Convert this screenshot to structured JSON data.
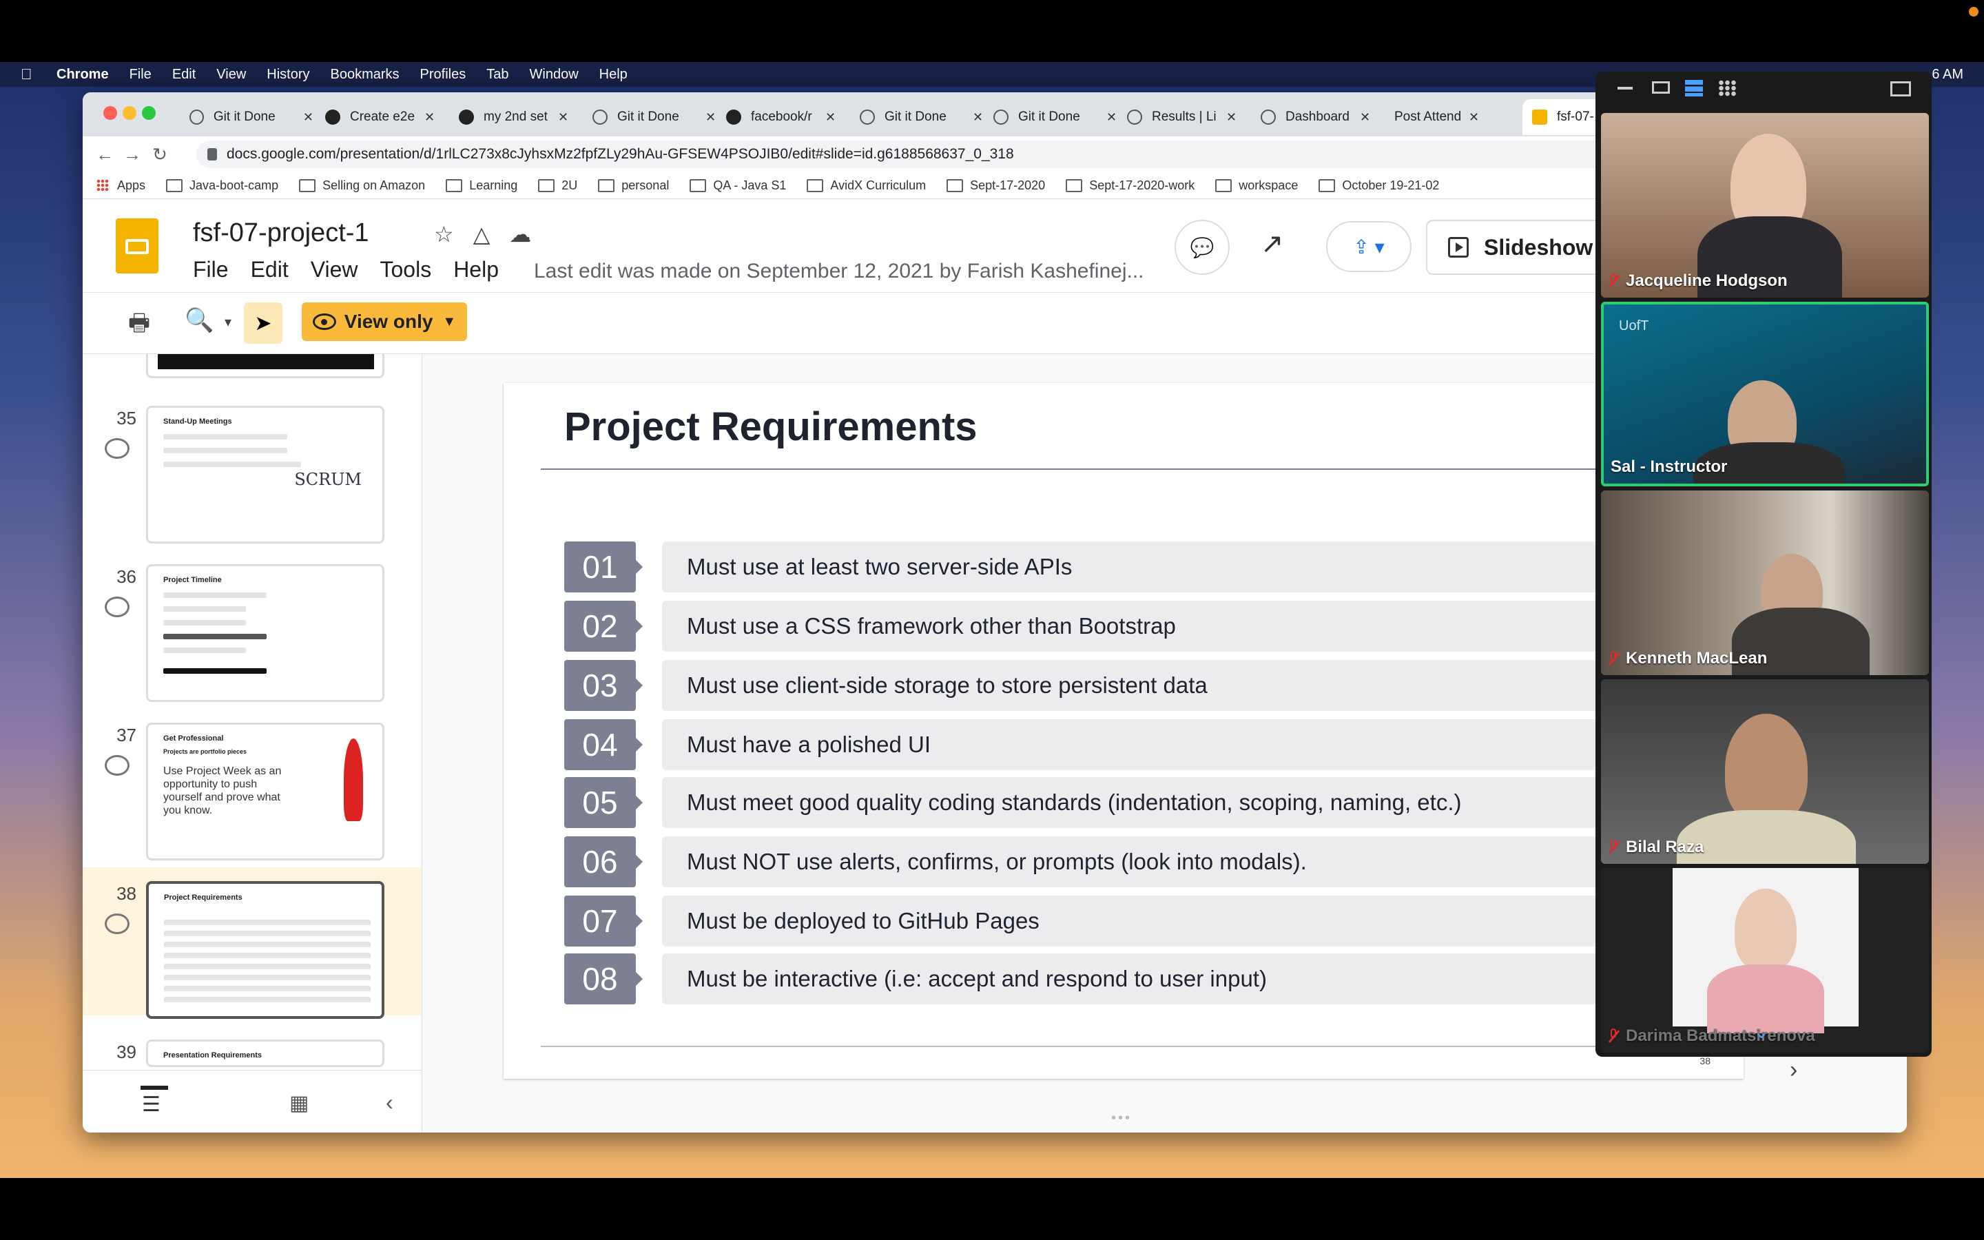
{
  "menubar": {
    "app": "Chrome",
    "items": [
      "File",
      "Edit",
      "View",
      "History",
      "Bookmarks",
      "Profiles",
      "Tab",
      "Window",
      "Help"
    ],
    "clock": "6 AM"
  },
  "browser": {
    "tabs": [
      {
        "label": "Git it Done",
        "icon": "globe-icon"
      },
      {
        "label": "Create e2e",
        "icon": "github-icon"
      },
      {
        "label": "my 2nd set",
        "icon": "github-icon"
      },
      {
        "label": "Git it Done",
        "icon": "globe-icon"
      },
      {
        "label": "facebook/r",
        "icon": "github-icon"
      },
      {
        "label": "Git it Done",
        "icon": "globe-icon"
      },
      {
        "label": "Git it Done",
        "icon": "globe-icon"
      },
      {
        "label": "Results | Li",
        "icon": "globe-icon"
      },
      {
        "label": "Dashboard",
        "icon": "globe-icon"
      },
      {
        "label": "Post Attend",
        "icon": "zoom-icon"
      },
      {
        "label": "fsf-07-",
        "icon": "slides-icon"
      }
    ],
    "url": "docs.google.com/presentation/d/1rlLC273x8cJyhsxMz2fpfZLy29hAu-GFSEW4PSOJIB0/edit#slide=id.g6188568637_0_318",
    "bookmarks": [
      "Apps",
      "Java-boot-camp",
      "Selling on Amazon",
      "Learning",
      "2U",
      "personal",
      "QA - Java S1",
      "AvidX Curriculum",
      "Sept-17-2020",
      "Sept-17-2020-work",
      "workspace",
      "October 19-21-02"
    ]
  },
  "doc": {
    "title": "fsf-07-project-1",
    "menu": [
      "File",
      "Edit",
      "View",
      "Tools",
      "Help"
    ],
    "last_edit": "Last edit was made on September 12, 2021 by Farish Kashefinej...",
    "slideshow_label": "Slideshow",
    "view_only_label": "View only"
  },
  "filmstrip": {
    "slides": [
      {
        "num": "35",
        "title": "Stand-Up Meetings"
      },
      {
        "num": "36",
        "title": "Project Timeline"
      },
      {
        "num": "37",
        "title": "Get Professional",
        "sub": "Projects are portfolio pieces",
        "body": "Use Project Week as an opportunity to push yourself and prove what you know."
      },
      {
        "num": "38",
        "title": "Project Requirements"
      },
      {
        "num": "39",
        "title": "Presentation Requirements"
      }
    ],
    "scrum_text": "SCRUM"
  },
  "slide": {
    "title": "Project Requirements",
    "page_number": "38",
    "requirements": [
      {
        "num": "01",
        "text": "Must use at least two server-side APIs"
      },
      {
        "num": "02",
        "text": "Must use a CSS framework other than Bootstrap"
      },
      {
        "num": "03",
        "text": "Must use client-side storage to store persistent data"
      },
      {
        "num": "04",
        "text": "Must have a polished UI"
      },
      {
        "num": "05",
        "text": "Must meet good quality coding standards (indentation, scoping, naming, etc.)"
      },
      {
        "num": "06",
        "text": "Must NOT use alerts, confirms, or prompts (look into modals)."
      },
      {
        "num": "07",
        "text": "Must be deployed to GitHub Pages"
      },
      {
        "num": "08",
        "text": "Must be interactive (i.e: accept and respond to user input)"
      }
    ]
  },
  "zoom": {
    "participants": [
      {
        "name": "Jacqueline  Hodgson",
        "muted": true
      },
      {
        "name": "Sal - Instructor",
        "muted": false,
        "active": true
      },
      {
        "name": "Kenneth MacLean",
        "muted": true
      },
      {
        "name": "Bilal Raza",
        "muted": true
      },
      {
        "name": "Darima Badmatsirenova",
        "muted": true
      }
    ],
    "uoft_label": "UofT"
  }
}
